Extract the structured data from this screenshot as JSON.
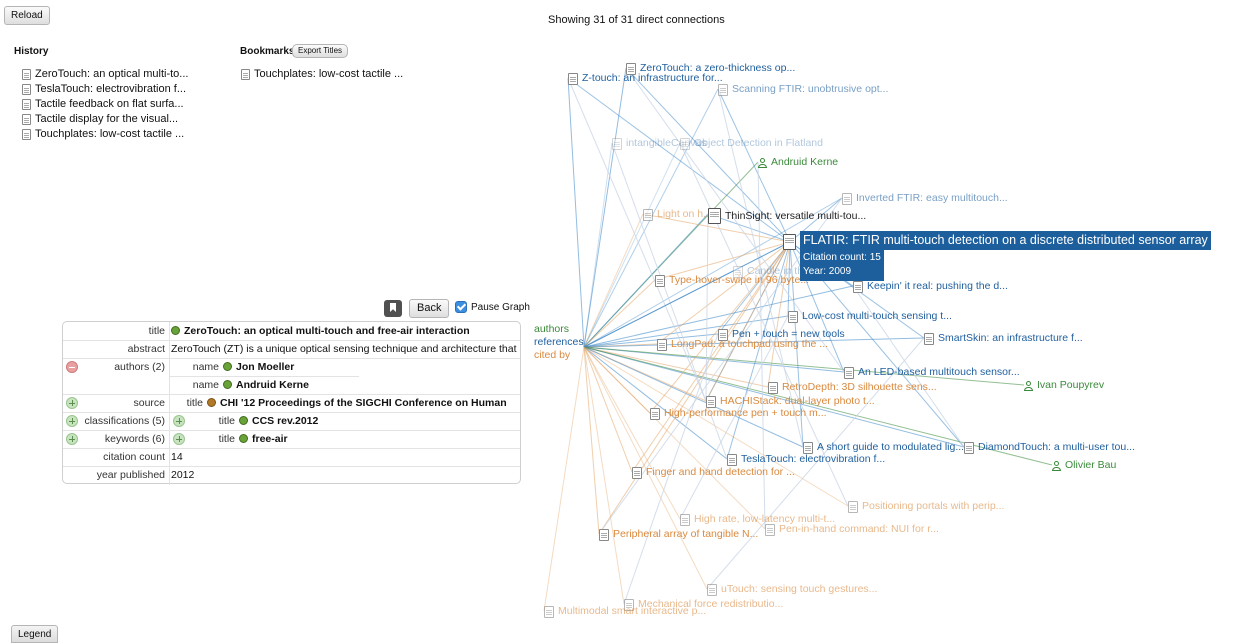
{
  "toolbar": {
    "reload_label": "Reload",
    "legend_label": "Legend"
  },
  "status_text": "Showing 31 of 31 direct connections",
  "history": {
    "heading": "History",
    "items": [
      "ZeroTouch: an optical multi-to...",
      "TeslaTouch: electrovibration f...",
      "Tactile feedback on flat surfa...",
      "Tactile display for the visual...",
      "Touchplates: low-cost tactile ..."
    ]
  },
  "bookmarks": {
    "heading": "Bookmarks",
    "export_label": "Export Titles",
    "items": [
      "Touchplates: low-cost tactile ..."
    ]
  },
  "controls": {
    "back_label": "Back",
    "pause_label": "Pause Graph",
    "pause_checked": true
  },
  "detail": {
    "title_label": "title",
    "title_value": "ZeroTouch: an optical multi-touch and free-air interaction",
    "abstract_label": "abstract",
    "abstract_value": "ZeroTouch (ZT) is a unique optical sensing technique and architecture that",
    "authors_label": "authors (2)",
    "authors": [
      {
        "field": "name",
        "value": "Jon Moeller"
      },
      {
        "field": "name",
        "value": "Andruid Kerne"
      }
    ],
    "source_label": "source",
    "source_field": "title",
    "source_value": "CHI '12 Proceedings of the SIGCHI Conference on Human",
    "classifications_label": "classifications (5)",
    "classifications_field": "title",
    "classifications_value": "CCS rev.2012",
    "keywords_label": "keywords (6)",
    "keywords_field": "title",
    "keywords_value": "free-air",
    "citation_label": "citation count",
    "citation_value": "14",
    "year_label": "year published",
    "year_value": "2012"
  },
  "graph": {
    "hub_labels": [
      "authors",
      "references",
      "cited by"
    ],
    "colors": {
      "author": "#3b8a3b",
      "reference": "#1f5f9e",
      "cited_by": "#d98a3f",
      "edge_ref": "#3a86c8",
      "edge_cite": "#e3a567"
    },
    "nodes": [
      {
        "label": "ZeroTouch: a zero-thickness op...",
        "kind": "reference",
        "fade": 0
      },
      {
        "label": "Z-touch: an infrastructure for...",
        "kind": "reference",
        "fade": 0
      },
      {
        "label": "Scanning FTIR: unobtrusive opt...",
        "kind": "reference",
        "fade": 1
      },
      {
        "label": "intangibleCanvas",
        "kind": "reference",
        "fade": 2
      },
      {
        "label": "Object Detection in Flatland",
        "kind": "reference",
        "fade": 2
      },
      {
        "label": "Andruid Kerne",
        "kind": "author",
        "fade": 0
      },
      {
        "label": "Inverted FTIR: easy multitouch...",
        "kind": "reference",
        "fade": 1
      },
      {
        "label": "Light on h...",
        "kind": "cited_by",
        "fade": 1
      },
      {
        "label": "ThinSight: versatile multi-tou...",
        "kind": "dark",
        "fade": 0
      },
      {
        "label": "Candle in the ...",
        "kind": "reference",
        "fade": 2
      },
      {
        "label": "Type-hover-swipe in 96 byte...",
        "kind": "cited_by",
        "fade": 0
      },
      {
        "label": "Keepin' it real: pushing the d...",
        "kind": "reference",
        "fade": 0
      },
      {
        "label": "Low-cost multi-touch sensing t...",
        "kind": "reference",
        "fade": 0
      },
      {
        "label": "Pen + touch = new tools",
        "kind": "reference",
        "fade": 0
      },
      {
        "label": "LongPad: a touchpad using the ...",
        "kind": "cited_by",
        "fade": 0
      },
      {
        "label": "SmartSkin: an infrastructure f...",
        "kind": "reference",
        "fade": 0
      },
      {
        "label": "An LED-based multitouch sensor...",
        "kind": "reference",
        "fade": 0
      },
      {
        "label": "Ivan Poupyrev",
        "kind": "author",
        "fade": 0
      },
      {
        "label": "RetroDepth: 3D silhouette sens...",
        "kind": "cited_by",
        "fade": 0
      },
      {
        "label": "HACHIStack: dual-layer photo t...",
        "kind": "cited_by",
        "fade": 0
      },
      {
        "label": "High-performance pen + touch m...",
        "kind": "cited_by",
        "fade": 0
      },
      {
        "label": "A short guide to modulated lig...",
        "kind": "reference",
        "fade": 0
      },
      {
        "label": "DiamondTouch: a multi-user tou...",
        "kind": "reference",
        "fade": 0
      },
      {
        "label": "TeslaTouch: electrovibration f...",
        "kind": "reference",
        "fade": 0
      },
      {
        "label": "Olivier Bau",
        "kind": "author",
        "fade": 0
      },
      {
        "label": "Finger and hand detection for ...",
        "kind": "cited_by",
        "fade": 0
      },
      {
        "label": "Positioning portals with perip...",
        "kind": "cited_by",
        "fade": 1
      },
      {
        "label": "High rate, low-latency multi-t...",
        "kind": "cited_by",
        "fade": 1
      },
      {
        "label": "Peripheral array of tangible N...",
        "kind": "cited_by",
        "fade": 0
      },
      {
        "label": "Pen-in-hand command: NUI for r...",
        "kind": "cited_by",
        "fade": 1
      },
      {
        "label": "uTouch: sensing touch gestures...",
        "kind": "cited_by",
        "fade": 1
      },
      {
        "label": "Mechanical force redistributio...",
        "kind": "cited_by",
        "fade": 1
      },
      {
        "label": "Multimodal smart interactive p...",
        "kind": "cited_by",
        "fade": 1
      }
    ],
    "tooltip": {
      "title": "FLATIR: FTIR multi-touch detection on a discrete distributed sensor array",
      "citation": "Citation count: 15",
      "year": "Year: 2009"
    }
  }
}
